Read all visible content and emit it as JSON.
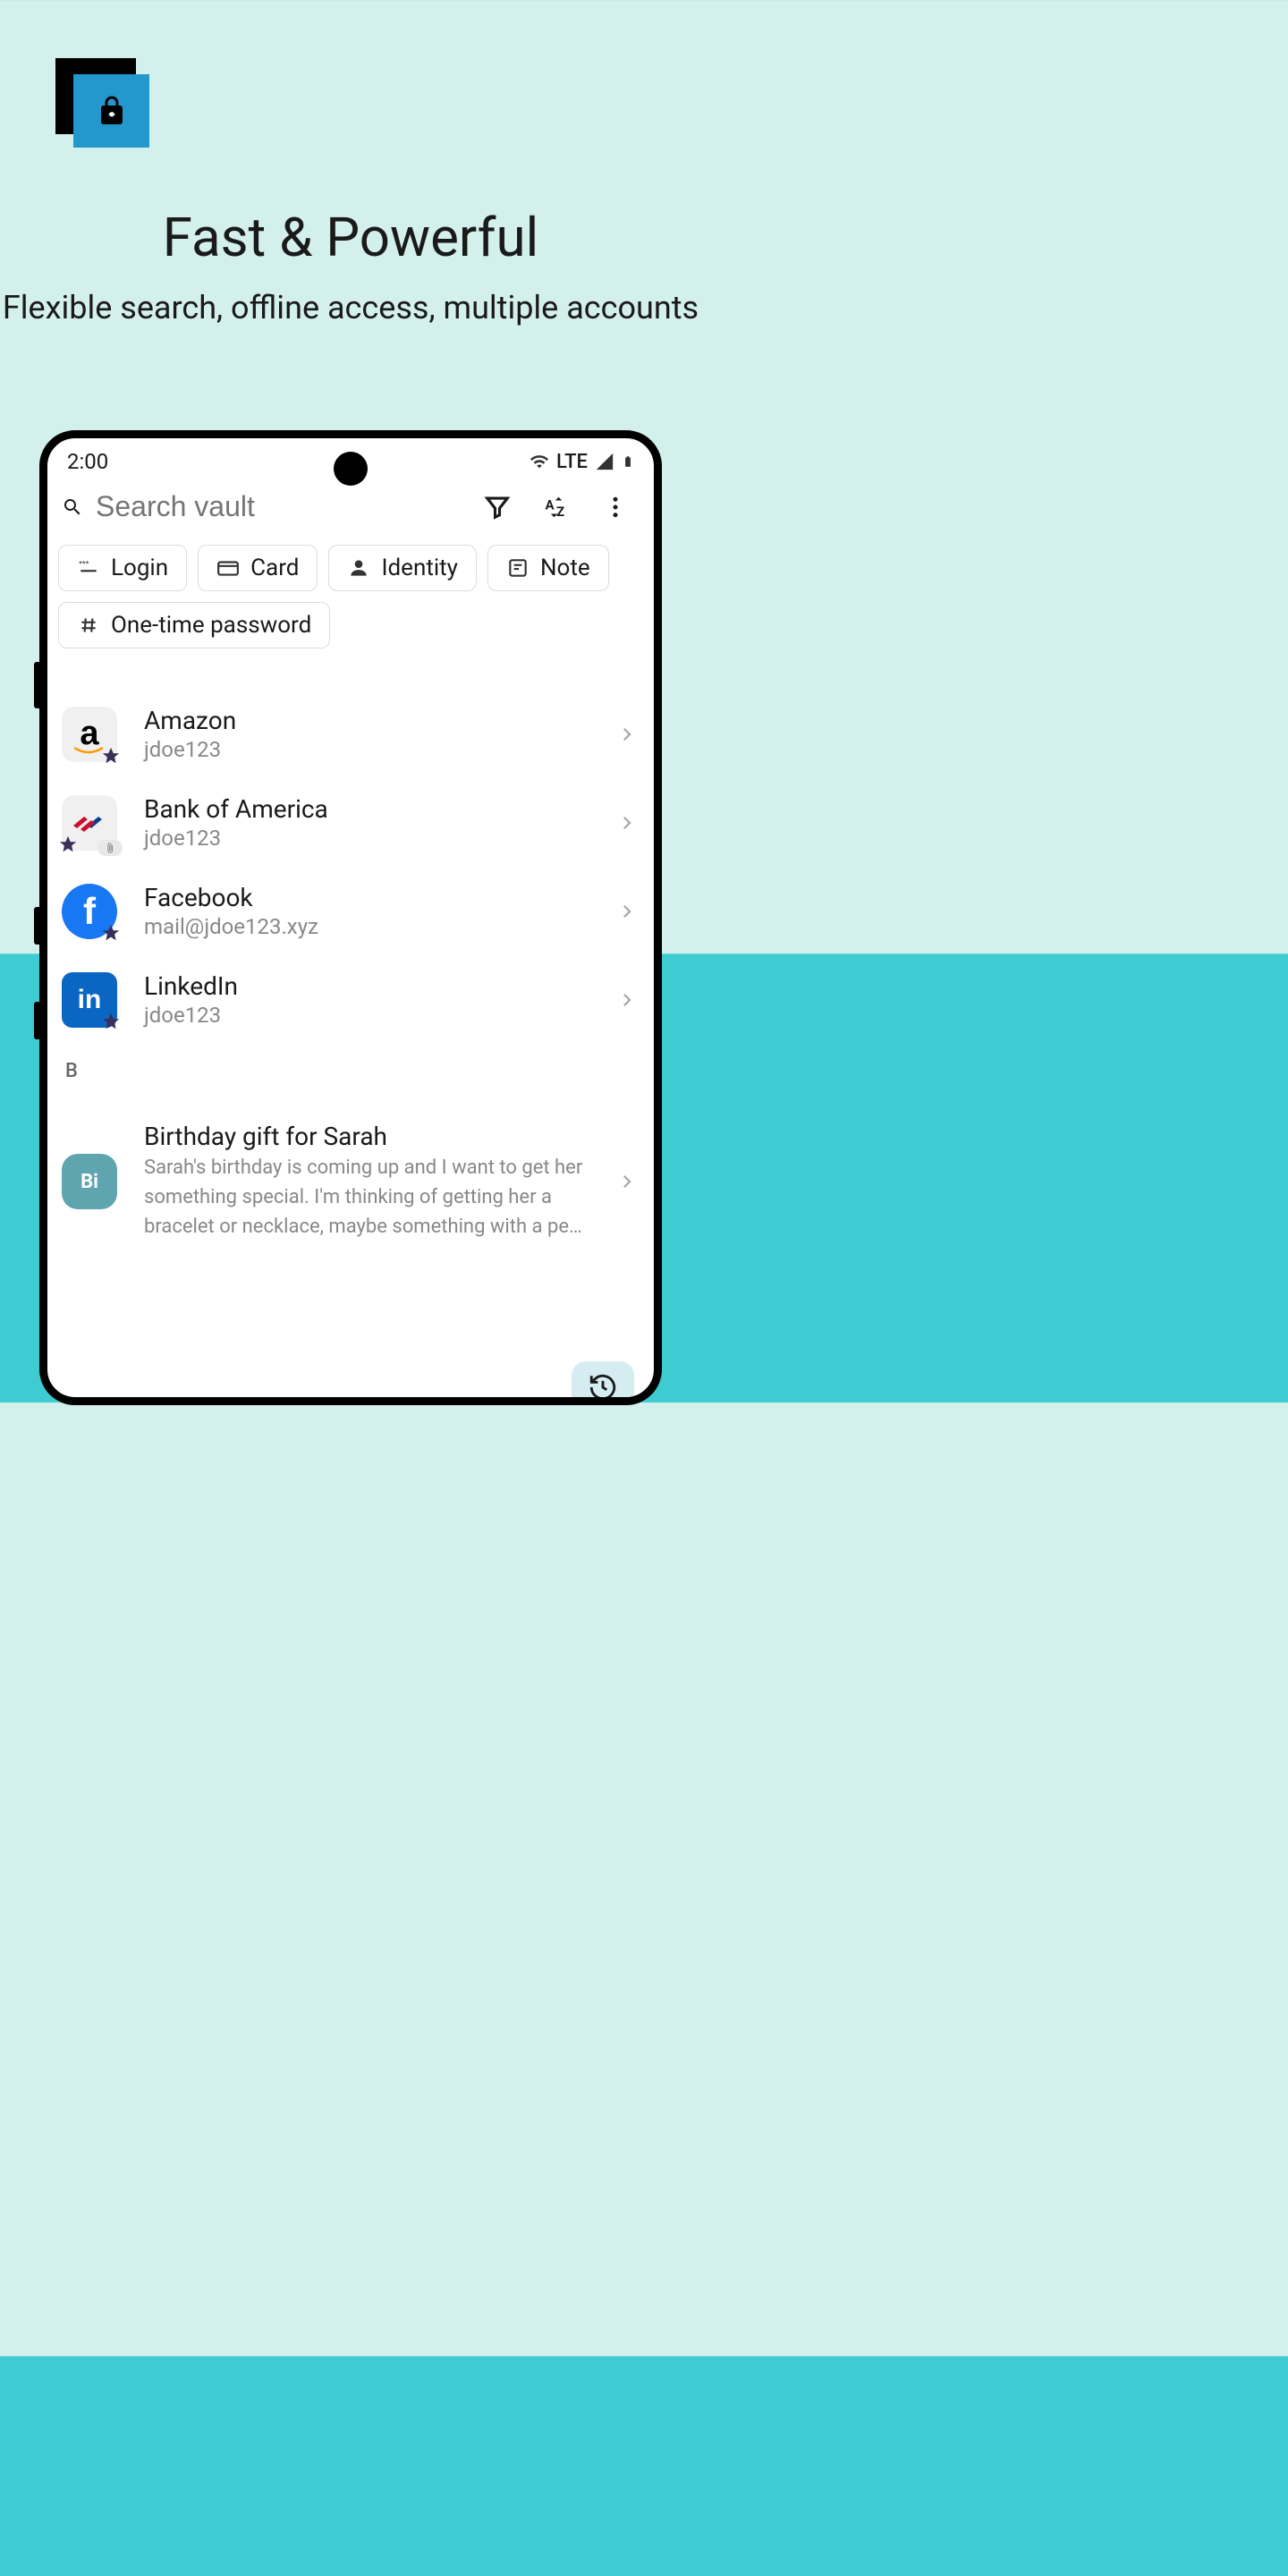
{
  "hero": {
    "title": "Fast & Powerful",
    "subtitle": "Flexible search, offline access, multiple accounts"
  },
  "status": {
    "time": "2:00",
    "network": "LTE"
  },
  "search": {
    "placeholder": "Search vault"
  },
  "chips": [
    {
      "label": "Login",
      "icon": "password"
    },
    {
      "label": "Card",
      "icon": "card"
    },
    {
      "label": "Identity",
      "icon": "person"
    },
    {
      "label": "Note",
      "icon": "note"
    },
    {
      "label": "One-time password",
      "icon": "hash"
    }
  ],
  "items": [
    {
      "title": "Amazon",
      "sub": "jdoe123",
      "avatar": "amazon"
    },
    {
      "title": "Bank of America",
      "sub": "jdoe123",
      "avatar": "boa"
    },
    {
      "title": "Facebook",
      "sub": "mail@jdoe123.xyz",
      "avatar": "fb"
    },
    {
      "title": "LinkedIn",
      "sub": "jdoe123",
      "avatar": "li"
    }
  ],
  "sectionB": "B",
  "note": {
    "title": "Birthday gift for Sarah",
    "body": "Sarah's birthday is coming up and I want to get her something special. I'm thinking of getting her a bracelet or necklace, maybe something with a pe…",
    "avatar": "Bi"
  }
}
